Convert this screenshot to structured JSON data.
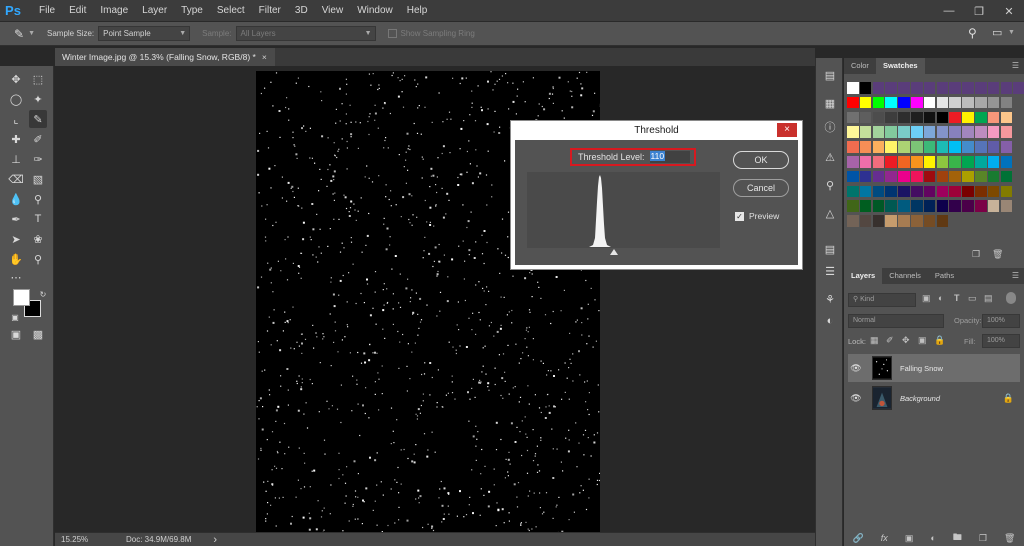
{
  "app": {
    "logo": "Ps",
    "menu": [
      "File",
      "Edit",
      "Image",
      "Layer",
      "Type",
      "Select",
      "Filter",
      "3D",
      "View",
      "Window",
      "Help"
    ]
  },
  "options_bar": {
    "sample_size_label": "Sample Size:",
    "sample_size_value": "Point Sample",
    "sample_label": "Sample:",
    "sample_value": "All Layers",
    "show_ring_label": "Show Sampling Ring"
  },
  "document": {
    "tab_title": "Winter Image.jpg @ 15.3% (Falling Snow, RGB/8) *",
    "tab_close": "×"
  },
  "status_bar": {
    "zoom": "15.25%",
    "doc_info": "Doc: 34.9M/69.8M",
    "arrow": "›"
  },
  "swatches_panel": {
    "tabs": [
      "Color",
      "Swatches"
    ],
    "active_tab": "Swatches",
    "rows": [
      [
        "#ffffff",
        "#000000",
        "#5a3d7a",
        "#5a3d7a",
        "#5a3d7a",
        "#5a3d7a",
        "#5a3d7a",
        "#5a3d7a",
        "#5a3d7a",
        "#5a3d7a",
        "#5a3d7a",
        "#5a3d7a",
        "#5a3d7a",
        "#5a3d7a"
      ],
      [
        "#ff0000",
        "#ffff00",
        "#00ff00",
        "#00ffff",
        "#0000ff",
        "#ff00ff",
        "#ffffff",
        "#e6e6e6",
        "#d0d0d0",
        "#bcbcbc",
        "#a8a8a8",
        "#959595",
        "#828282"
      ],
      [
        "#707070",
        "#5e5e5e",
        "#4d4d4d",
        "#3d3d3d",
        "#2e2e2e",
        "#1f1f1f",
        "#111111",
        "#000000",
        "#ed1c24",
        "#fff200",
        "#00a651",
        "#f7977a",
        "#fdc68a"
      ],
      [
        "#fff799",
        "#c4df9b",
        "#a3d39c",
        "#82ca9d",
        "#7accc8",
        "#6dcff6",
        "#7da7d9",
        "#8393ca",
        "#8781bd",
        "#a186be",
        "#bd8cbf",
        "#f49ac1",
        "#f5989d"
      ],
      [
        "#f26c4f",
        "#f68e56",
        "#fbaf5d",
        "#fff568",
        "#acd373",
        "#7cc576",
        "#3cb878",
        "#1cbbb4",
        "#00bff3",
        "#448ccb",
        "#5674b9",
        "#605ca8",
        "#855fa8"
      ],
      [
        "#a763a8",
        "#f06eaa",
        "#f26d7d",
        "#ed1c24",
        "#f26522",
        "#f7941d",
        "#fff200",
        "#8dc63f",
        "#39b54a",
        "#00a651",
        "#00a99d",
        "#00aeef",
        "#0072bc"
      ],
      [
        "#0054a6",
        "#2e3192",
        "#662d91",
        "#92278f",
        "#ec008c",
        "#ed145b",
        "#9e0b0f",
        "#a0410d",
        "#a36209",
        "#aba000",
        "#598527",
        "#197b30",
        "#007236"
      ],
      [
        "#00746b",
        "#0076a3",
        "#004b80",
        "#003471",
        "#1b1464",
        "#440e62",
        "#630460",
        "#9e005d",
        "#9e0039",
        "#790000",
        "#7b2e00",
        "#7d4900",
        "#827b00"
      ],
      [
        "#406618",
        "#005e20",
        "#005826",
        "#005952",
        "#005b7f",
        "#003663",
        "#002157",
        "#0d004c",
        "#32004b",
        "#4b0049",
        "#7b0046",
        "#c7b299",
        "#998675"
      ],
      [
        "#736357",
        "#534741",
        "#37302d",
        "#c69c6d",
        "#a67c52",
        "#8c6239",
        "#754c24",
        "#603913"
      ]
    ]
  },
  "layers_panel": {
    "tabs": [
      "Layers",
      "Channels",
      "Paths"
    ],
    "active_tab": "Layers",
    "kind_filter": "Kind",
    "blend_mode": "Normal",
    "opacity_label": "Opacity:",
    "opacity_value": "100%",
    "lock_label": "Lock:",
    "fill_label": "Fill:",
    "fill_value": "100%",
    "layers": [
      {
        "name": "Falling Snow",
        "visible": true,
        "selected": true
      },
      {
        "name": "Background",
        "visible": true,
        "selected": false,
        "locked": true
      }
    ],
    "footer_icons": [
      "link-icon",
      "fx-icon",
      "mask-icon",
      "adjustment-icon",
      "folder-icon",
      "new-layer-icon",
      "trash-icon"
    ]
  },
  "threshold_dialog": {
    "title": "Threshold",
    "close": "×",
    "level_label": "Threshold Level:",
    "level_value": "110",
    "ok_label": "OK",
    "cancel_label": "Cancel",
    "preview_label": "Preview",
    "preview_checked": true,
    "highlight_color": "#d71920"
  }
}
